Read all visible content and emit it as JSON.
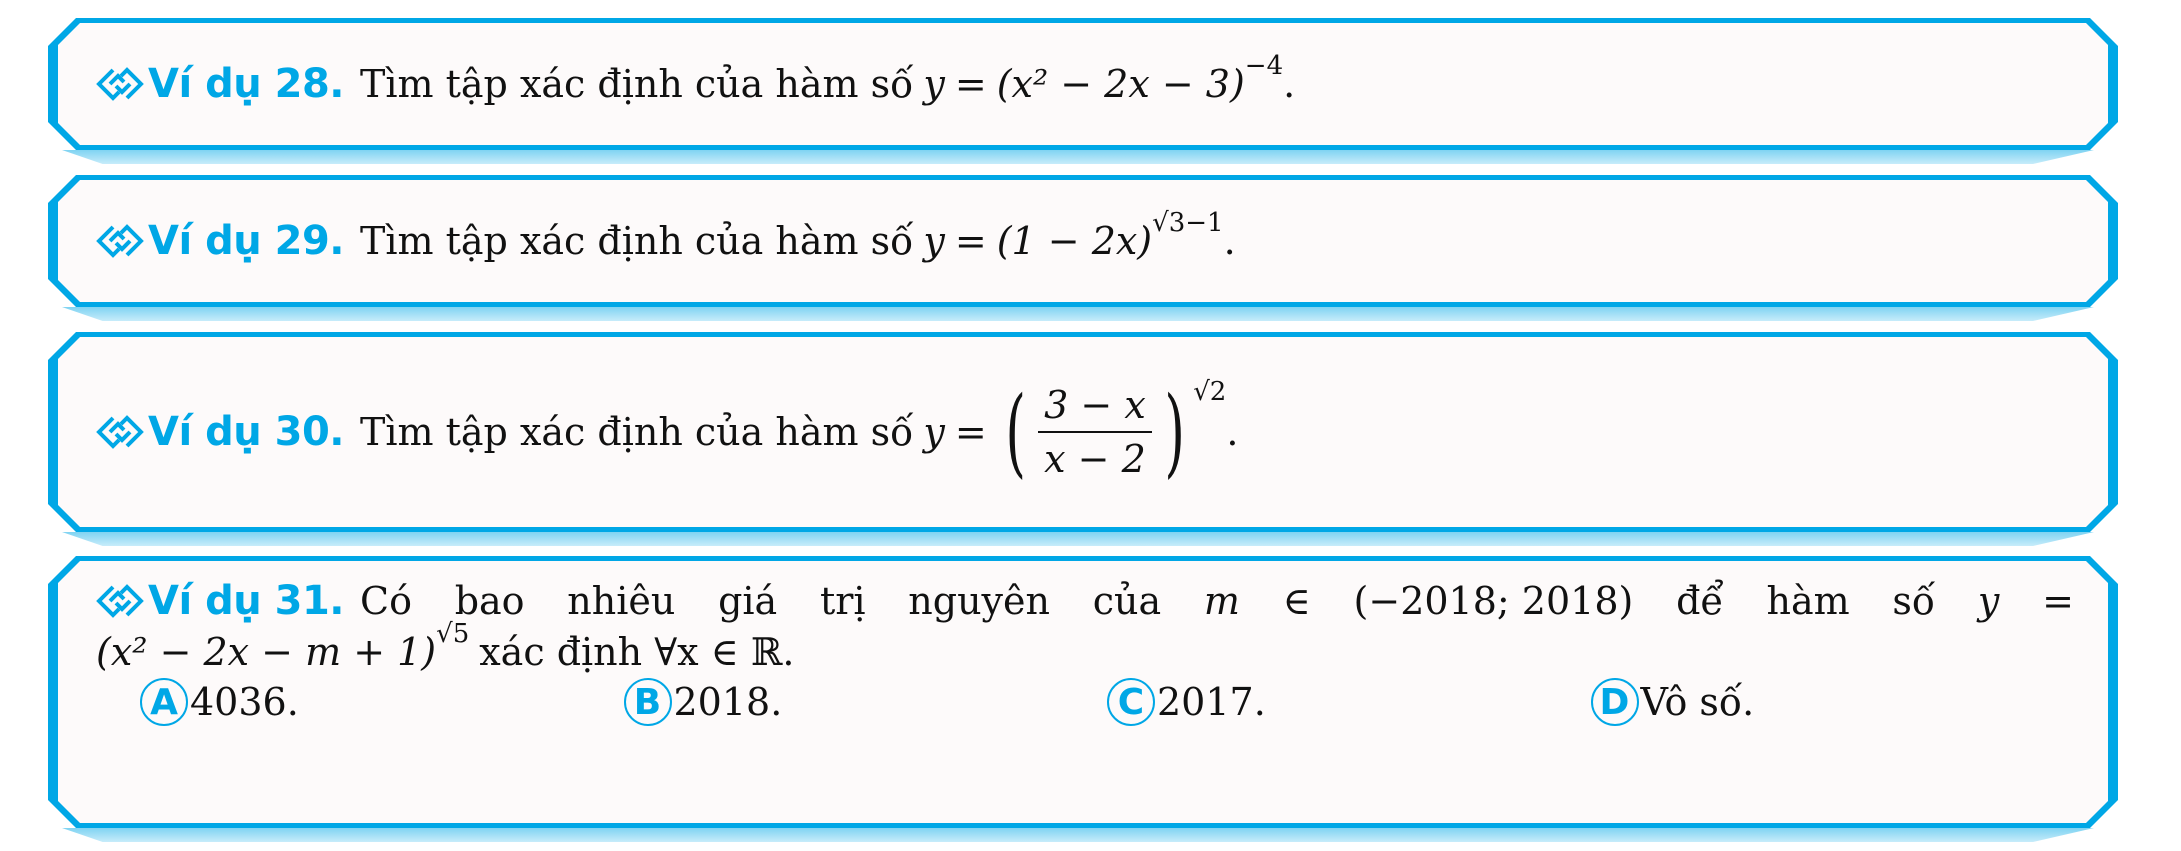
{
  "theme": {
    "accent": "#00a7e6",
    "panel_bg": "#fdfafa",
    "text": "#111111"
  },
  "examples": [
    {
      "label": "Ví dụ 28.",
      "icon": "interlocked-diamonds-icon",
      "prompt": "Tìm tập xác định của hàm số",
      "formula": {
        "lhs": "y",
        "eq": "=",
        "base": "(x² − 2x − 3)",
        "exponent": "−4",
        "end": "."
      }
    },
    {
      "label": "Ví dụ 29.",
      "icon": "interlocked-diamonds-icon",
      "prompt": "Tìm tập xác định của hàm số",
      "formula": {
        "lhs": "y",
        "eq": "=",
        "base": "(1 − 2x)",
        "exponent": "√3−1",
        "end": "."
      }
    },
    {
      "label": "Ví dụ 30.",
      "icon": "interlocked-diamonds-icon",
      "prompt": "Tìm tập xác định của hàm số",
      "formula": {
        "lhs": "y",
        "eq": "=",
        "numerator": "3 − x",
        "denominator": "x − 2",
        "exponent": "√2",
        "end": "."
      }
    },
    {
      "label": "Ví dụ 31.",
      "icon": "interlocked-diamonds-icon",
      "line1_words": [
        "Có",
        "bao",
        "nhiêu",
        "giá",
        "trị",
        "nguyên",
        "của",
        "m",
        "∈",
        "(−2018; 2018)",
        "để",
        "hàm",
        "số",
        "y",
        "="
      ],
      "line2": {
        "base": "(x² − 2x − m + 1)",
        "exponent": "√5",
        "rest": "xác định ∀x ∈ ℝ."
      },
      "options": [
        {
          "letter": "A",
          "text": "4036."
        },
        {
          "letter": "B",
          "text": "2018."
        },
        {
          "letter": "C",
          "text": "2017."
        },
        {
          "letter": "D",
          "text": "Vô số."
        }
      ]
    }
  ]
}
